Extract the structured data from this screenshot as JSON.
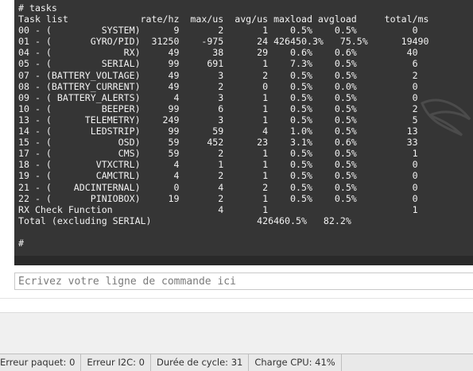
{
  "console": {
    "lines": [
      "# tasks",
      "Task list             rate/hz  max/us  avg/us maxload avgload     total/ms",
      "00 - (         SYSTEM)      9       2       1    0.5%    0.5%          0",
      "01 - (       GYRO/PID)  31250    -975      24 426450.3%   75.5%      19490",
      "04 - (             RX)     49      38      29    0.6%    0.6%         40",
      "05 - (         SERIAL)     99     691       1    7.3%    0.5%          6",
      "07 - (BATTERY_VOLTAGE)     49       3       2    0.5%    0.5%          2",
      "08 - (BATTERY_CURRENT)     49       2       0    0.5%    0.0%          0",
      "09 - ( BATTERY_ALERTS)      4       3       1    0.5%    0.5%          0",
      "10 - (         BEEPER)     99       6       1    0.5%    0.5%          2",
      "13 - (      TELEMETRY)    249       3       1    0.5%    0.5%          5",
      "14 - (       LEDSTRIP)     99      59       4    1.0%    0.5%         13",
      "15 - (            OSD)     59     452      23    3.1%    0.6%         33",
      "17 - (            CMS)     59       2       1    0.5%    0.5%          1",
      "18 - (        VTXCTRL)      4       1       1    0.5%    0.5%          0",
      "19 - (        CAMCTRL)      4       2       1    0.5%    0.5%          0",
      "21 - (    ADCINTERNAL)      0       4       2    0.5%    0.5%          0",
      "22 - (       PINIOBOX)     19       2       1    0.5%    0.5%          0",
      "RX Check Function                   4       1                          1",
      "Total (excluding SERIAL)                   426460.5%   82.2%",
      "",
      "#"
    ]
  },
  "command_input": {
    "placeholder": "Écrivez votre ligne de commande ici"
  },
  "status_bar": {
    "packet_error": "Erreur paquet: 0",
    "i2c_error": "Erreur I2C: 0",
    "cycle_time": "Durée de cycle: 31",
    "cpu_load": "Charge CPU: 41%"
  },
  "colors": {
    "console_bg": "#353535",
    "console_text": "#f2f2f2"
  }
}
